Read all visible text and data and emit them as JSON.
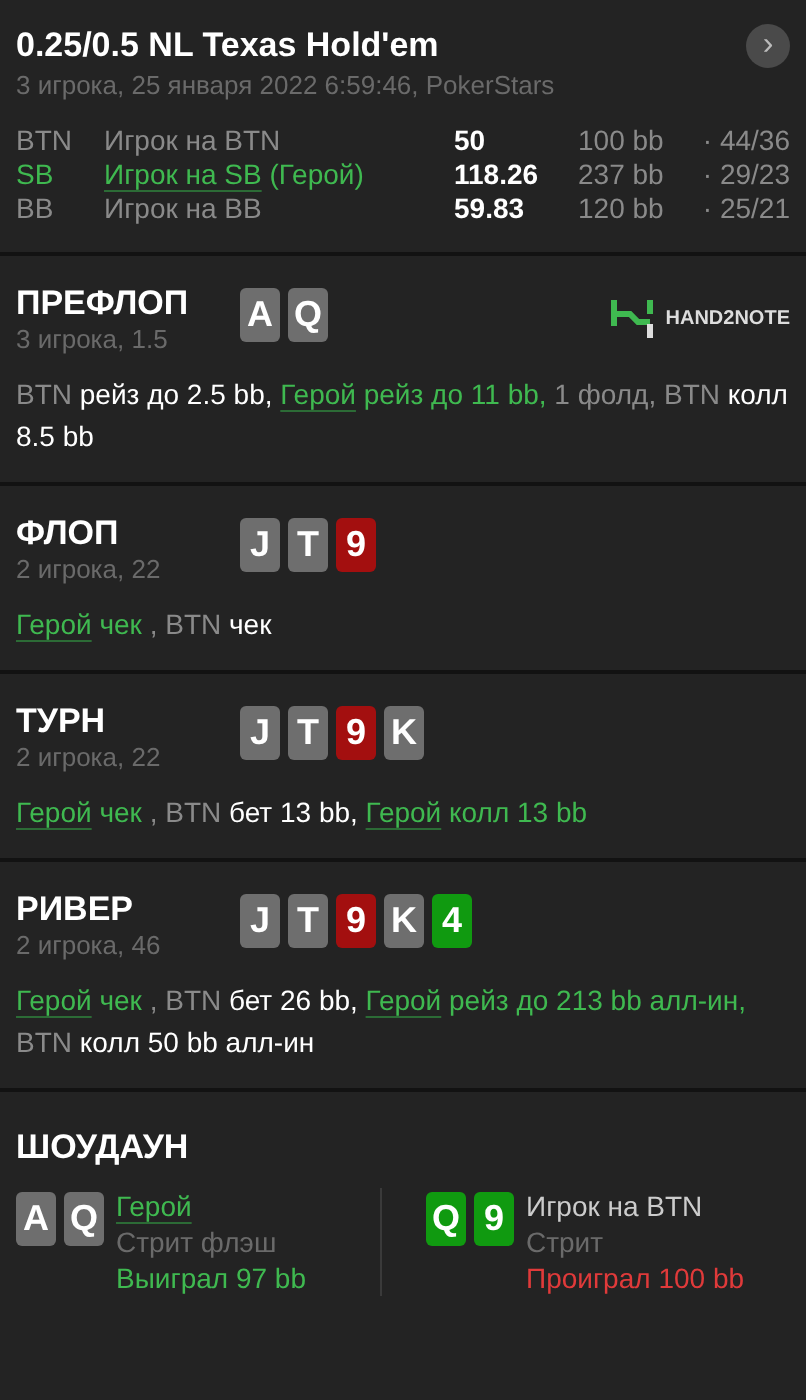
{
  "header": {
    "title": "0.25/0.5 NL Texas Hold'em",
    "subtitle": "3 игрока, 25 января 2022 6:59:46, PokerStars",
    "next_button": "›"
  },
  "players": [
    {
      "position": "BTN",
      "name": "Игрок на BTN",
      "hero": false,
      "stack": "50",
      "bb": "100 bb",
      "stats": "· 44/36"
    },
    {
      "position": "SB",
      "name": "Игрок на SB",
      "hero_tag": "(Герой)",
      "hero": true,
      "stack": "118.26",
      "bb": "237 bb",
      "stats": "· 29/23"
    },
    {
      "position": "BB",
      "name": "Игрок на BB",
      "hero": false,
      "stack": "59.83",
      "bb": "120 bb",
      "stats": "· 25/21"
    }
  ],
  "streets": [
    {
      "name": "ПРЕФЛОП",
      "info": "3 игрока, 1.5",
      "logo": "HAND2NOTE",
      "cards": [
        {
          "rank": "A",
          "color": "#6e6e6e"
        },
        {
          "rank": "Q",
          "color": "#6e6e6e"
        }
      ],
      "actions": [
        {
          "text": "BTN",
          "kind": "player"
        },
        {
          "text": " рейз до 2.5 bb, ",
          "kind": "move"
        },
        {
          "text": "Герой",
          "kind": "hero"
        },
        {
          "text": " рейз до 11 bb,",
          "kind": "heromove"
        },
        {
          "text": " 1 фолд, BTN",
          "kind": "player"
        },
        {
          "text": " колл 8.5 bb",
          "kind": "move"
        }
      ]
    },
    {
      "name": "ФЛОП",
      "info": "2 игрока, 22",
      "cards": [
        {
          "rank": "J",
          "color": "#6e6e6e"
        },
        {
          "rank": "T",
          "color": "#6e6e6e"
        },
        {
          "rank": "9",
          "color": "#a30f0f"
        }
      ],
      "actions": [
        {
          "text": "Герой",
          "kind": "hero"
        },
        {
          "text": " чек",
          "kind": "heromove"
        },
        {
          "text": " , BTN",
          "kind": "player"
        },
        {
          "text": " чек",
          "kind": "move"
        }
      ]
    },
    {
      "name": "ТУРН",
      "info": "2 игрока, 22",
      "cards": [
        {
          "rank": "J",
          "color": "#6e6e6e"
        },
        {
          "rank": "T",
          "color": "#6e6e6e"
        },
        {
          "rank": "9",
          "color": "#a30f0f"
        },
        {
          "rank": "K",
          "color": "#6e6e6e"
        }
      ],
      "actions": [
        {
          "text": "Герой",
          "kind": "hero"
        },
        {
          "text": " чек",
          "kind": "heromove"
        },
        {
          "text": " , BTN",
          "kind": "player"
        },
        {
          "text": " бет 13 bb, ",
          "kind": "move"
        },
        {
          "text": "Герой",
          "kind": "hero"
        },
        {
          "text": " колл 13 bb",
          "kind": "heromove"
        }
      ]
    },
    {
      "name": "РИВЕР",
      "info": "2 игрока, 46",
      "cards": [
        {
          "rank": "J",
          "color": "#6e6e6e"
        },
        {
          "rank": "T",
          "color": "#6e6e6e"
        },
        {
          "rank": "9",
          "color": "#a30f0f"
        },
        {
          "rank": "K",
          "color": "#6e6e6e"
        },
        {
          "rank": "4",
          "color": "#109a10"
        }
      ],
      "actions": [
        {
          "text": "Герой",
          "kind": "hero"
        },
        {
          "text": " чек",
          "kind": "heromove"
        },
        {
          "text": " , BTN",
          "kind": "player"
        },
        {
          "text": " бет 26 bb, ",
          "kind": "move"
        },
        {
          "text": "Герой",
          "kind": "hero"
        },
        {
          "text": " рейз до 213 bb алл-ин,",
          "kind": "heromove"
        },
        {
          "text": " BTN",
          "kind": "player"
        },
        {
          "text": " колл 50 bb алл-ин",
          "kind": "move"
        }
      ]
    }
  ],
  "showdown": {
    "title": "ШОУДАУН",
    "hands": [
      {
        "cards": [
          {
            "rank": "A",
            "color": "#6e6e6e"
          },
          {
            "rank": "Q",
            "color": "#6e6e6e"
          }
        ],
        "name": "Герой",
        "hero": true,
        "hand": "Стрит флэш",
        "result": "Выиграл 97 bb",
        "won": true
      },
      {
        "cards": [
          {
            "rank": "Q",
            "color": "#109a10"
          },
          {
            "rank": "9",
            "color": "#109a10"
          }
        ],
        "name": "Игрок на BTN",
        "hero": false,
        "hand": "Стрит",
        "result": "Проиграл 100 bb",
        "won": false
      }
    ]
  }
}
